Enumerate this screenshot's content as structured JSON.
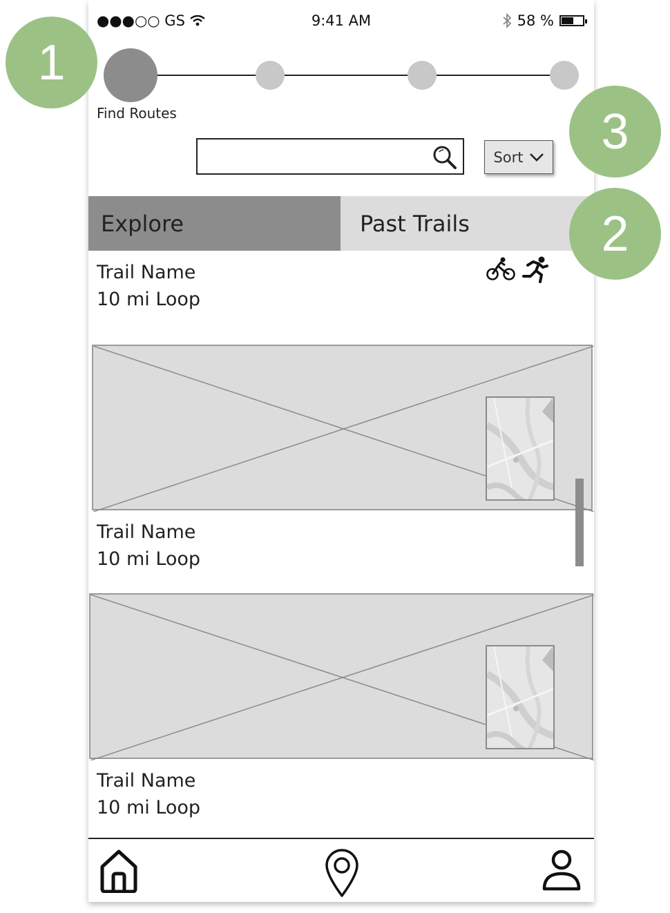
{
  "status_bar": {
    "carrier": "●●●○○ GS",
    "time": "9:41 AM",
    "battery": "58 %",
    "battery_level": 0.58
  },
  "progress": {
    "current_step_label": "Find Routes",
    "current_step": 1,
    "total_steps": 4
  },
  "search": {
    "value": "",
    "placeholder": ""
  },
  "sort": {
    "label": "Sort"
  },
  "tabs": [
    {
      "label": "Explore",
      "active": true
    },
    {
      "label": "Past Trails",
      "active": false
    }
  ],
  "trails": [
    {
      "name": "Trail Name",
      "distance": "10 mi Loop"
    },
    {
      "name": "Trail Name",
      "distance": "10 mi Loop"
    },
    {
      "name": "Trail Name",
      "distance": "10 mi Loop"
    }
  ],
  "activity_icons": [
    "bike-icon",
    "running-icon"
  ],
  "bottom_nav": [
    "home-icon",
    "location-pin-icon",
    "profile-icon"
  ],
  "annotations": [
    "1",
    "2",
    "3"
  ],
  "colors": {
    "annotation": "#9cc185",
    "active_step": "#8c8c8c",
    "inactive_step": "#c8c8c8",
    "active_tab": "#8c8c8c",
    "inactive_tab": "#dcdcdc",
    "placeholder": "#dcdcdc"
  }
}
